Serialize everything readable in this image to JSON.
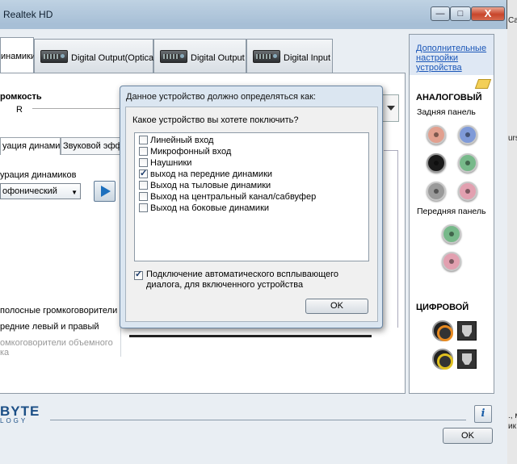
{
  "window": {
    "title": "Realtek HD",
    "min_label": "—",
    "max_label": "□",
    "close_label": "X"
  },
  "tabs": [
    {
      "label": "инамики"
    },
    {
      "label": "Digital Output(Optical)"
    },
    {
      "label": "Digital Output"
    },
    {
      "label": "Digital Input"
    }
  ],
  "volume": {
    "label": "ромкость",
    "channel": "R"
  },
  "subtabs": [
    "уация динамиков",
    "Звуковой эффе"
  ],
  "config": {
    "label": "урация динамиков",
    "selected": "офонический"
  },
  "options": {
    "fullrange": "полосные громкоговорители",
    "front_lr": "редние левый и правый",
    "surround_1": "омкоговорители объемного",
    "surround_2": "ка"
  },
  "brand": {
    "name": "BYTE",
    "sub": "LOGY"
  },
  "side_panel": {
    "advanced_link": "Дополнительные настройки устройства",
    "analog_title": "АНАЛОГОВЫЙ",
    "rear_label": "Задняя панель",
    "front_label": "Передняя панель",
    "digital_title": "ЦИФРОВОЙ"
  },
  "main_ok": "OK",
  "info_label": "i",
  "dialog": {
    "title": "Данное устройство должно определяться как:",
    "question": "Какое устройство вы хотете поключить?",
    "items": [
      {
        "label": "Линейный вход",
        "checked": false
      },
      {
        "label": "Микрофонный вход",
        "checked": false
      },
      {
        "label": "Наушники",
        "checked": false
      },
      {
        "label": "выход на передние динамики",
        "checked": true
      },
      {
        "label": "Выход на тыловые динамики",
        "checked": false
      },
      {
        "label": "Выход на центральный канал/сабвуфер",
        "checked": false
      },
      {
        "label": "Выход на боковые динамики",
        "checked": false
      }
    ],
    "auto_popup": {
      "label": "Подключение автоматического всплывающего диалога, для включенного устройства",
      "checked": true
    },
    "ok": "OK"
  },
  "right_strip": {
    "top": "Ca",
    "mid1": "urs",
    "low1": "., м",
    "low2": "ик"
  },
  "colors": {
    "link": "#1a56b8",
    "brand": "#1c4f86",
    "close": "#c8452a"
  }
}
